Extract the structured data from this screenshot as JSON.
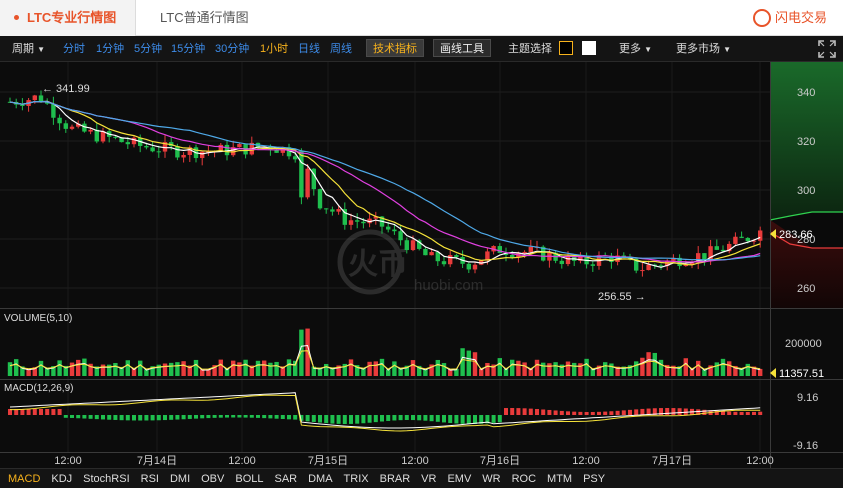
{
  "tabs": {
    "active": "LTC专业行情图",
    "second": "LTC普通行情图"
  },
  "brand": {
    "name": "闪电交易"
  },
  "toolbar": {
    "period_label": "周期",
    "periods": [
      "分时",
      "1分钟",
      "5分钟",
      "15分钟",
      "30分钟",
      "1小时",
      "日线",
      "周线"
    ],
    "selected_period": "1小时",
    "tech_indicator": "技术指标",
    "drawing_tools": "画线工具",
    "theme_label": "主题选择",
    "more": "更多",
    "more_markets": "更多市场"
  },
  "colors": {
    "up": "#e83b3b",
    "down": "#1fbf4e",
    "ma1": "#ffffff",
    "ma2": "#f5e23a",
    "ma3": "#e040e0",
    "ma4": "#4fa9e8",
    "accent": "#e8542a"
  },
  "main_chart": {
    "y_ticks": [
      "340",
      "320",
      "300",
      "280",
      "260"
    ],
    "high_label": "← 341.99",
    "low_label": "256.55 →",
    "current_price": "283.66"
  },
  "volume_panel": {
    "title": "VOLUME(5,10)",
    "tick": "200000",
    "current": "11357.51"
  },
  "macd_panel": {
    "title": "MACD(12,26,9)",
    "tick_top": "9.16",
    "tick_bottom": "-9.16"
  },
  "x_axis": {
    "labels": [
      "12:00",
      "7月14日",
      "12:00",
      "7月15日",
      "12:00",
      "7月16日",
      "12:00",
      "7月17日",
      "12:00"
    ]
  },
  "indicators": [
    "MACD",
    "KDJ",
    "StochRSI",
    "RSI",
    "DMI",
    "OBV",
    "BOLL",
    "SAR",
    "DMA",
    "TRIX",
    "BRAR",
    "VR",
    "EMV",
    "WR",
    "ROC",
    "MTM",
    "PSY"
  ],
  "active_indicator": "MACD",
  "watermark": "huobi.com"
}
